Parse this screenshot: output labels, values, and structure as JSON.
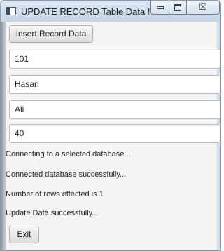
{
  "window": {
    "title": "UPDATE RECORD Table Data !",
    "close_glyph": "☒"
  },
  "toolbar": {
    "insert_label": "Insert Record Data"
  },
  "fields": {
    "id": "101",
    "first_name": "Hasan",
    "last_name": "Ali",
    "age": "40"
  },
  "status": {
    "line1": "Connecting to a selected database...",
    "line2": "Connected database successfully...",
    "line3": "Number of rows effected is 1",
    "line4": "Update Data successfully..."
  },
  "footer": {
    "exit_label": "Exit"
  },
  "colors": {
    "titlebar": "#cddcec",
    "background": "#f4f4f4",
    "field_border": "#b9b9b9"
  }
}
